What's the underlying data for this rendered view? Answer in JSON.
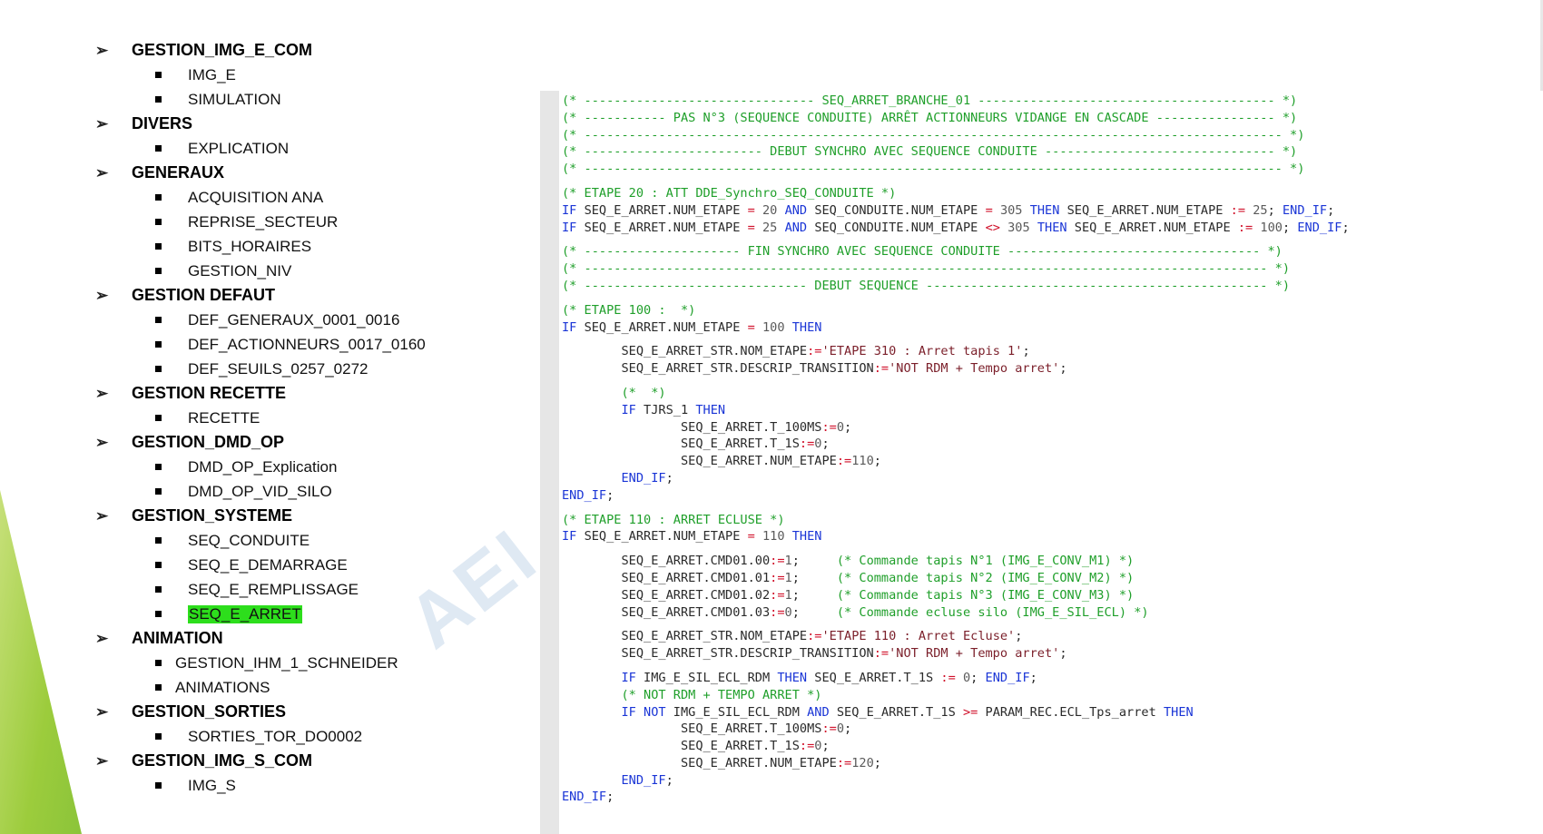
{
  "tree": [
    {
      "label": "GESTION_IMG_E_COM",
      "children": [
        "IMG_E",
        "SIMULATION"
      ]
    },
    {
      "label": "DIVERS",
      "children": [
        "EXPLICATION"
      ]
    },
    {
      "label": "GENERAUX",
      "children": [
        "ACQUISITION ANA",
        "REPRISE_SECTEUR",
        "BITS_HORAIRES",
        "GESTION_NIV"
      ]
    },
    {
      "label": "GESTION DEFAUT",
      "children": [
        "DEF_GENERAUX_0001_0016",
        "DEF_ACTIONNEURS_0017_0160",
        "DEF_SEUILS_0257_0272"
      ]
    },
    {
      "label": "GESTION RECETTE",
      "children": [
        "RECETTE"
      ]
    },
    {
      "label": "GESTION_DMD_OP",
      "children": [
        "DMD_OP_Explication",
        "DMD_OP_VID_SILO"
      ]
    },
    {
      "label": "GESTION_SYSTEME",
      "children": [
        "SEQ_CONDUITE",
        "SEQ_E_DEMARRAGE",
        "SEQ_E_REMPLISSAGE",
        "SEQ_E_ARRET"
      ]
    },
    {
      "label": "ANIMATION",
      "children": [
        "GESTION_IHM_1_SCHNEIDER",
        "ANIMATIONS"
      ]
    },
    {
      "label": "GESTION_SORTIES",
      "children": [
        "SORTIES_TOR_DO0002"
      ]
    },
    {
      "label": "GESTION_IMG_S_COM",
      "children": [
        "IMG_S"
      ]
    }
  ],
  "selected": "SEQ_E_ARRET",
  "watermark": "AEI",
  "code": [
    [
      [
        "c",
        "(* ------------------------------- SEQ_ARRET_BRANCHE_01 ---------------------------------------- *)"
      ]
    ],
    [
      [
        "c",
        "(* ----------- PAS N°3 (SEQUENCE CONDUITE) ARRÊT ACTIONNEURS VIDANGE EN CASCADE ---------------- *)"
      ]
    ],
    [
      [
        "c",
        "(* ---------------------------------------------------------------------------------------------- *)"
      ]
    ],
    [
      [
        "c",
        "(* ------------------------ DEBUT SYNCHRO AVEC SEQUENCE CONDUITE ------------------------------- *)"
      ]
    ],
    [
      [
        "c",
        "(* ---------------------------------------------------------------------------------------------- *)"
      ]
    ],
    "gap",
    [
      [
        "c",
        "(* ETAPE 20 : ATT DDE_Synchro_SEQ_CONDUITE *)"
      ]
    ],
    [
      [
        "k",
        "IF "
      ],
      [
        "v",
        "SEQ_E_ARRET.NUM_ETAPE "
      ],
      [
        "o",
        "= "
      ],
      [
        "n",
        "20 "
      ],
      [
        "k",
        "AND "
      ],
      [
        "v",
        "SEQ_CONDUITE.NUM_ETAPE "
      ],
      [
        "o",
        "= "
      ],
      [
        "n",
        "305 "
      ],
      [
        "k",
        "THEN "
      ],
      [
        "v",
        "SEQ_E_ARRET.NUM_ETAPE "
      ],
      [
        "o",
        ":= "
      ],
      [
        "n",
        "25"
      ],
      [
        "v",
        "; "
      ],
      [
        "k",
        "END_IF"
      ],
      [
        "v",
        ";"
      ]
    ],
    [
      [
        "k",
        "IF "
      ],
      [
        "v",
        "SEQ_E_ARRET.NUM_ETAPE "
      ],
      [
        "o",
        "= "
      ],
      [
        "n",
        "25 "
      ],
      [
        "k",
        "AND "
      ],
      [
        "v",
        "SEQ_CONDUITE.NUM_ETAPE "
      ],
      [
        "o",
        "<> "
      ],
      [
        "n",
        "305 "
      ],
      [
        "k",
        "THEN "
      ],
      [
        "v",
        "SEQ_E_ARRET.NUM_ETAPE "
      ],
      [
        "o",
        ":= "
      ],
      [
        "n",
        "100"
      ],
      [
        "v",
        "; "
      ],
      [
        "k",
        "END_IF"
      ],
      [
        "v",
        ";"
      ]
    ],
    "gap",
    [
      [
        "c",
        "(* --------------------- FIN SYNCHRO AVEC SEQUENCE CONDUITE ---------------------------------- *)"
      ]
    ],
    [
      [
        "c",
        "(* -------------------------------------------------------------------------------------------- *)"
      ]
    ],
    [
      [
        "c",
        "(* ------------------------------ DEBUT SEQUENCE ---------------------------------------------- *)"
      ]
    ],
    "gap",
    [
      [
        "c",
        "(* ETAPE 100 :  *)"
      ]
    ],
    [
      [
        "k",
        "IF "
      ],
      [
        "v",
        "SEQ_E_ARRET.NUM_ETAPE "
      ],
      [
        "o",
        "= "
      ],
      [
        "n",
        "100 "
      ],
      [
        "k",
        "THEN"
      ]
    ],
    "gap",
    [
      [
        "v",
        "        SEQ_E_ARRET_STR.NOM_ETAPE"
      ],
      [
        "o",
        ":="
      ],
      [
        "s",
        "'ETAPE 310 : Arret tapis 1'"
      ],
      [
        "v",
        ";"
      ]
    ],
    [
      [
        "v",
        "        SEQ_E_ARRET_STR.DESCRIP_TRANSITION"
      ],
      [
        "o",
        ":="
      ],
      [
        "s",
        "'NOT RDM + Tempo arret'"
      ],
      [
        "v",
        ";"
      ]
    ],
    "gap",
    [
      [
        "c",
        "        (*  *)"
      ]
    ],
    [
      [
        "k",
        "        IF "
      ],
      [
        "v",
        "TJRS_1 "
      ],
      [
        "k",
        "THEN"
      ]
    ],
    [
      [
        "v",
        "                SEQ_E_ARRET.T_100MS"
      ],
      [
        "o",
        ":="
      ],
      [
        "n",
        "0"
      ],
      [
        "v",
        ";"
      ]
    ],
    [
      [
        "v",
        "                SEQ_E_ARRET.T_1S"
      ],
      [
        "o",
        ":="
      ],
      [
        "n",
        "0"
      ],
      [
        "v",
        ";"
      ]
    ],
    [
      [
        "v",
        "                SEQ_E_ARRET.NUM_ETAPE"
      ],
      [
        "o",
        ":="
      ],
      [
        "n",
        "110"
      ],
      [
        "v",
        ";"
      ]
    ],
    [
      [
        "k",
        "        END_IF"
      ],
      [
        "v",
        ";"
      ]
    ],
    [
      [
        "k",
        "END_IF"
      ],
      [
        "v",
        ";"
      ]
    ],
    "gap",
    [
      [
        "c",
        "(* ETAPE 110 : ARRET ECLUSE *)"
      ]
    ],
    [
      [
        "k",
        "IF "
      ],
      [
        "v",
        "SEQ_E_ARRET.NUM_ETAPE "
      ],
      [
        "o",
        "= "
      ],
      [
        "n",
        "110 "
      ],
      [
        "k",
        "THEN"
      ]
    ],
    "gap",
    [
      [
        "v",
        "        SEQ_E_ARRET.CMD01.00"
      ],
      [
        "o",
        ":="
      ],
      [
        "n",
        "1"
      ],
      [
        "v",
        ";     "
      ],
      [
        "c",
        "(* Commande tapis N°1 (IMG_E_CONV_M1) *)"
      ]
    ],
    [
      [
        "v",
        "        SEQ_E_ARRET.CMD01.01"
      ],
      [
        "o",
        ":="
      ],
      [
        "n",
        "1"
      ],
      [
        "v",
        ";     "
      ],
      [
        "c",
        "(* Commande tapis N°2 (IMG_E_CONV_M2) *)"
      ]
    ],
    [
      [
        "v",
        "        SEQ_E_ARRET.CMD01.02"
      ],
      [
        "o",
        ":="
      ],
      [
        "n",
        "1"
      ],
      [
        "v",
        ";     "
      ],
      [
        "c",
        "(* Commande tapis N°3 (IMG_E_CONV_M3) *)"
      ]
    ],
    [
      [
        "v",
        "        SEQ_E_ARRET.CMD01.03"
      ],
      [
        "o",
        ":="
      ],
      [
        "n",
        "0"
      ],
      [
        "v",
        ";     "
      ],
      [
        "c",
        "(* Commande ecluse silo (IMG_E_SIL_ECL) *)"
      ]
    ],
    "gap",
    [
      [
        "v",
        "        SEQ_E_ARRET_STR.NOM_ETAPE"
      ],
      [
        "o",
        ":="
      ],
      [
        "s",
        "'ETAPE 110 : Arret Ecluse'"
      ],
      [
        "v",
        ";"
      ]
    ],
    [
      [
        "v",
        "        SEQ_E_ARRET_STR.DESCRIP_TRANSITION"
      ],
      [
        "o",
        ":="
      ],
      [
        "s",
        "'NOT RDM + Tempo arret'"
      ],
      [
        "v",
        ";"
      ]
    ],
    "gap",
    [
      [
        "k",
        "        IF "
      ],
      [
        "v",
        "IMG_E_SIL_ECL_RDM "
      ],
      [
        "k",
        "THEN "
      ],
      [
        "v",
        "SEQ_E_ARRET.T_1S "
      ],
      [
        "o",
        ":= "
      ],
      [
        "n",
        "0"
      ],
      [
        "v",
        "; "
      ],
      [
        "k",
        "END_IF"
      ],
      [
        "v",
        ";"
      ]
    ],
    [
      [
        "c",
        "        (* NOT RDM + TEMPO ARRET *)"
      ]
    ],
    [
      [
        "k",
        "        IF NOT "
      ],
      [
        "v",
        "IMG_E_SIL_ECL_RDM "
      ],
      [
        "k",
        "AND "
      ],
      [
        "v",
        "SEQ_E_ARRET.T_1S "
      ],
      [
        "o",
        ">= "
      ],
      [
        "v",
        "PARAM_REC.ECL_Tps_arret "
      ],
      [
        "k",
        "THEN"
      ]
    ],
    [
      [
        "v",
        "                SEQ_E_ARRET.T_100MS"
      ],
      [
        "o",
        ":="
      ],
      [
        "n",
        "0"
      ],
      [
        "v",
        ";"
      ]
    ],
    [
      [
        "v",
        "                SEQ_E_ARRET.T_1S"
      ],
      [
        "o",
        ":="
      ],
      [
        "n",
        "0"
      ],
      [
        "v",
        ";"
      ]
    ],
    [
      [
        "v",
        "                SEQ_E_ARRET.NUM_ETAPE"
      ],
      [
        "o",
        ":="
      ],
      [
        "n",
        "120"
      ],
      [
        "v",
        ";"
      ]
    ],
    [
      [
        "k",
        "        END_IF"
      ],
      [
        "v",
        ";"
      ]
    ],
    [
      [
        "k",
        "END_IF"
      ],
      [
        "v",
        ";"
      ]
    ]
  ]
}
